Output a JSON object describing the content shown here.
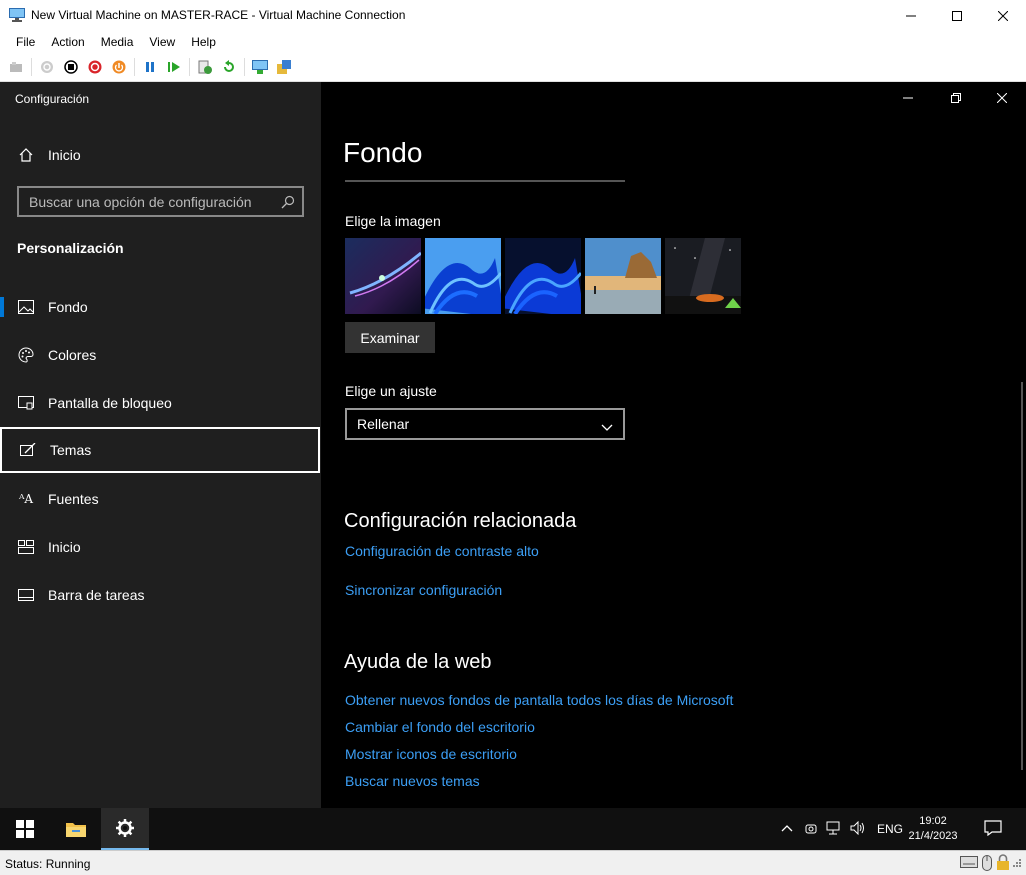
{
  "window": {
    "title": "New Virtual Machine on MASTER-RACE - Virtual Machine Connection"
  },
  "menu": [
    "File",
    "Action",
    "Media",
    "View",
    "Help"
  ],
  "settings": {
    "app_title": "Configuración",
    "home_label": "Inicio",
    "search_placeholder": "Buscar una opción de configuración",
    "section": "Personalización",
    "nav": [
      "Fondo",
      "Colores",
      "Pantalla de bloqueo",
      "Temas",
      "Fuentes",
      "Inicio",
      "Barra de tareas"
    ]
  },
  "content": {
    "page_title": "Fondo",
    "choose_image": "Elige la imagen",
    "browse": "Examinar",
    "choose_fit": "Elige un ajuste",
    "fit_value": "Rellenar",
    "related_heading": "Configuración relacionada",
    "related_links": [
      "Configuración de contraste alto",
      "Sincronizar configuración"
    ],
    "help_heading": "Ayuda de la web",
    "help_links": [
      "Obtener nuevos fondos de pantalla todos los días de Microsoft",
      "Cambiar el fondo del escritorio",
      "Mostrar iconos de escritorio",
      "Buscar nuevos temas"
    ]
  },
  "taskbar": {
    "lang": "ENG",
    "time": "19:02",
    "date": "21/4/2023"
  },
  "status": {
    "text": "Status: Running"
  },
  "colors": {
    "accent": "#0078d7",
    "link": "#3c9ff5"
  }
}
